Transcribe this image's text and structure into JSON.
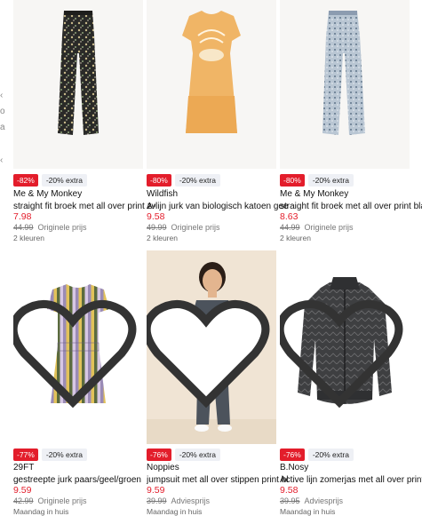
{
  "edge_marks": [
    "‹",
    "o",
    "a",
    "‹"
  ],
  "products": [
    {
      "brand": "Me & My Monkey",
      "name": "straight fit broek met all over print zwart",
      "price": "7.98",
      "original_price": "44.99",
      "original_label": "Originele prijs",
      "discount": "-82%",
      "extra": "-20% extra",
      "meta": "2 kleuren",
      "image_icon": "black-patterned-trousers",
      "has_heart": false
    },
    {
      "brand": "Wildfish",
      "name": "A-lijn jurk van biologisch katoen geel",
      "price": "9.58",
      "original_price": "49.99",
      "original_label": "Originele prijs",
      "discount": "-80%",
      "extra": "-20% extra",
      "meta": "2 kleuren",
      "image_icon": "yellow-print-dress",
      "has_heart": false
    },
    {
      "brand": "Me & My Monkey",
      "name": "straight fit broek met all over print blauw",
      "price": "8.63",
      "original_price": "44.99",
      "original_label": "Originele prijs",
      "discount": "-80%",
      "extra": "-20% extra",
      "meta": "2 kleuren",
      "image_icon": "blue-patterned-trousers",
      "has_heart": false
    },
    {
      "brand": "29FT",
      "name": "gestreepte jurk paars/geel/groen",
      "price": "9.59",
      "original_price": "42.99",
      "original_label": "Originele prijs",
      "discount": "-77%",
      "extra": "-20% extra",
      "meta": "Maandag in huis",
      "image_icon": "striped-dress",
      "has_heart": true
    },
    {
      "brand": "Noppies",
      "name": "jumpsuit met all over stippen print blauw",
      "price": "9.59",
      "original_price": "39.99",
      "original_label": "Adviesprijs",
      "discount": "-76%",
      "extra": "-20% extra",
      "meta": "Maandag in huis",
      "image_icon": "girl-in-jumpsuit",
      "has_heart": true
    },
    {
      "brand": "B.Nosy",
      "name": "Active lijn zomerjas met all over print grijs",
      "price": "9.58",
      "original_price": "39.95",
      "original_label": "Adviesprijs",
      "discount": "-76%",
      "extra": "-20% extra",
      "meta": "Maandag in huis",
      "image_icon": "grey-jacket",
      "has_heart": true
    }
  ],
  "colors": {
    "sale_red": "#e31d2b",
    "badge_grey": "#eef0f5"
  }
}
